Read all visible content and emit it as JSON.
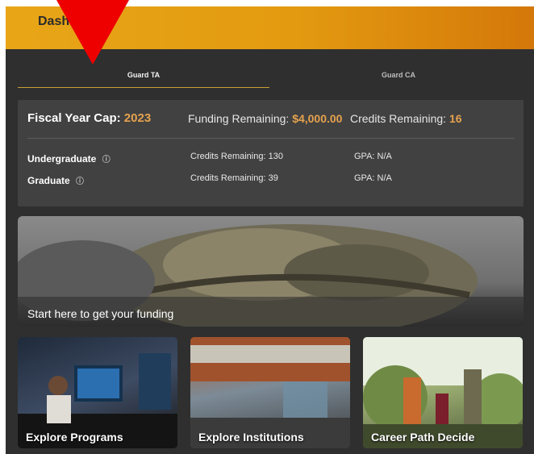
{
  "header": {
    "title": "Dashb"
  },
  "tabs": [
    {
      "label": "Guard TA"
    },
    {
      "label": "Guard CA"
    }
  ],
  "summary": {
    "fiscal_year_label": "Fiscal Year Cap:",
    "fiscal_year_value": "2023",
    "funding_label": "Funding Remaining:",
    "funding_value": "$4,000.00",
    "credits_label": "Credits Remaining:",
    "credits_value": "16",
    "info_icon": "ⓘ",
    "rows": [
      {
        "label": "Undergraduate",
        "credits": "Credits Remaining: 130",
        "gpa": "GPA: N/A"
      },
      {
        "label": "Graduate",
        "credits": "Credits Remaining: 39",
        "gpa": "GPA: N/A"
      }
    ]
  },
  "hero": {
    "text": "Start here to get your funding"
  },
  "cards": [
    {
      "label": "Explore Programs"
    },
    {
      "label": "Explore Institutions"
    },
    {
      "label": "Career Path Decide"
    }
  ],
  "colors": {
    "header": "#e39a10",
    "accent": "#e5a24f",
    "panel": "#414141",
    "frame": "#2f2f2f",
    "arrow": "#ee0000"
  }
}
